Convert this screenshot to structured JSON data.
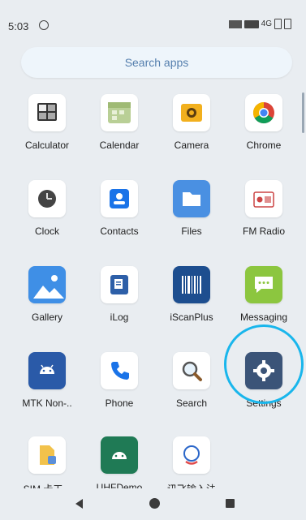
{
  "status_bar": {
    "time": "5:03",
    "network": "4G"
  },
  "search": {
    "label": "Search apps"
  },
  "apps": [
    {
      "label": "Calculator"
    },
    {
      "label": "Calendar"
    },
    {
      "label": "Camera"
    },
    {
      "label": "Chrome"
    },
    {
      "label": "Clock"
    },
    {
      "label": "Contacts"
    },
    {
      "label": "Files"
    },
    {
      "label": "FM Radio"
    },
    {
      "label": "Gallery"
    },
    {
      "label": "iLog"
    },
    {
      "label": "iScanPlus"
    },
    {
      "label": "Messaging"
    },
    {
      "label": "MTK Non-.."
    },
    {
      "label": "Phone"
    },
    {
      "label": "Search"
    },
    {
      "label": "Settings"
    },
    {
      "label": "SIM 卡工..."
    },
    {
      "label": "UHFDemo"
    },
    {
      "label": "讯飞输入法"
    }
  ],
  "colors": {
    "highlight": "#19b6ec",
    "accent": "#557fae"
  }
}
